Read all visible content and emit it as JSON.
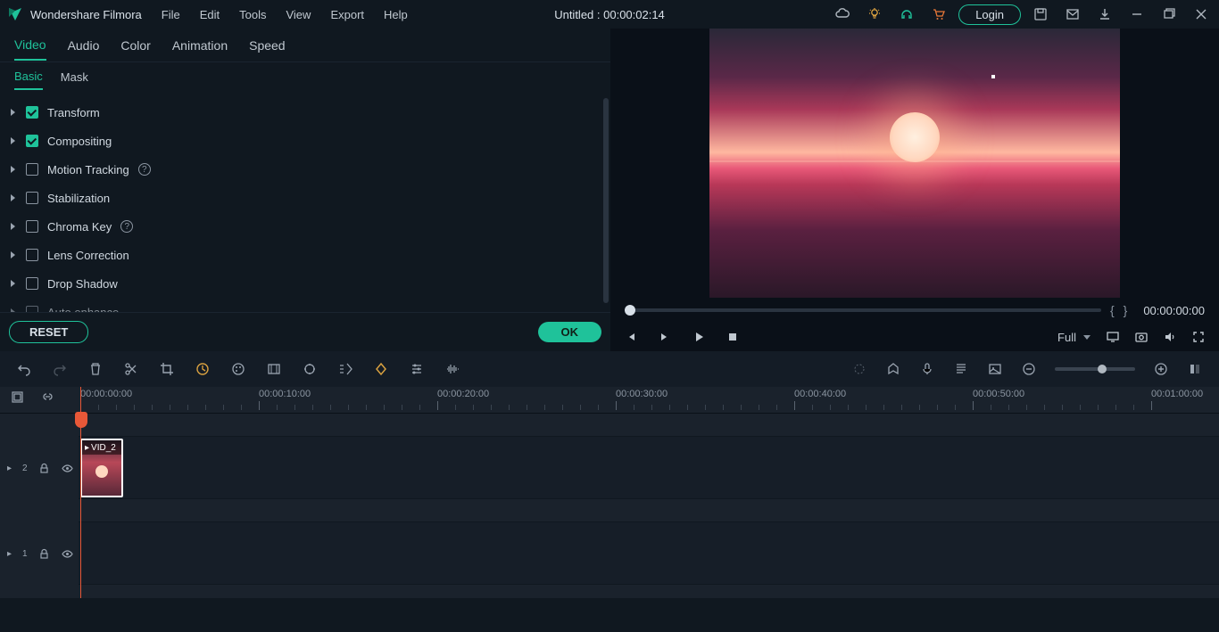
{
  "app": {
    "name": "Wondershare Filmora"
  },
  "menubar": [
    "File",
    "Edit",
    "Tools",
    "View",
    "Export",
    "Help"
  ],
  "project": {
    "title": "Untitled : 00:00:02:14"
  },
  "titlebar_right": {
    "login": "Login"
  },
  "editor_tabs": [
    "Video",
    "Audio",
    "Color",
    "Animation",
    "Speed"
  ],
  "editor_tabs_active": 0,
  "subtab": [
    "Basic",
    "Mask"
  ],
  "subtab_active": 0,
  "properties": [
    {
      "label": "Transform",
      "checked": true,
      "help": false
    },
    {
      "label": "Compositing",
      "checked": true,
      "help": false
    },
    {
      "label": "Motion Tracking",
      "checked": false,
      "help": true
    },
    {
      "label": "Stabilization",
      "checked": false,
      "help": false
    },
    {
      "label": "Chroma Key",
      "checked": false,
      "help": true
    },
    {
      "label": "Lens Correction",
      "checked": false,
      "help": false
    },
    {
      "label": "Drop Shadow",
      "checked": false,
      "help": false
    },
    {
      "label": "Auto enhance",
      "checked": false,
      "help": false
    }
  ],
  "buttons": {
    "reset": "RESET",
    "ok": "OK"
  },
  "preview": {
    "timecode": "00:00:00:00",
    "quality": "Full"
  },
  "ruler": [
    "00:00:00:00",
    "00:00:10:00",
    "00:00:20:00",
    "00:00:30:00",
    "00:00:40:00",
    "00:00:50:00",
    "00:01:00:00"
  ],
  "clip": {
    "label": "VID_2"
  },
  "tracks": [
    {
      "index": "2"
    },
    {
      "index": "1"
    }
  ]
}
